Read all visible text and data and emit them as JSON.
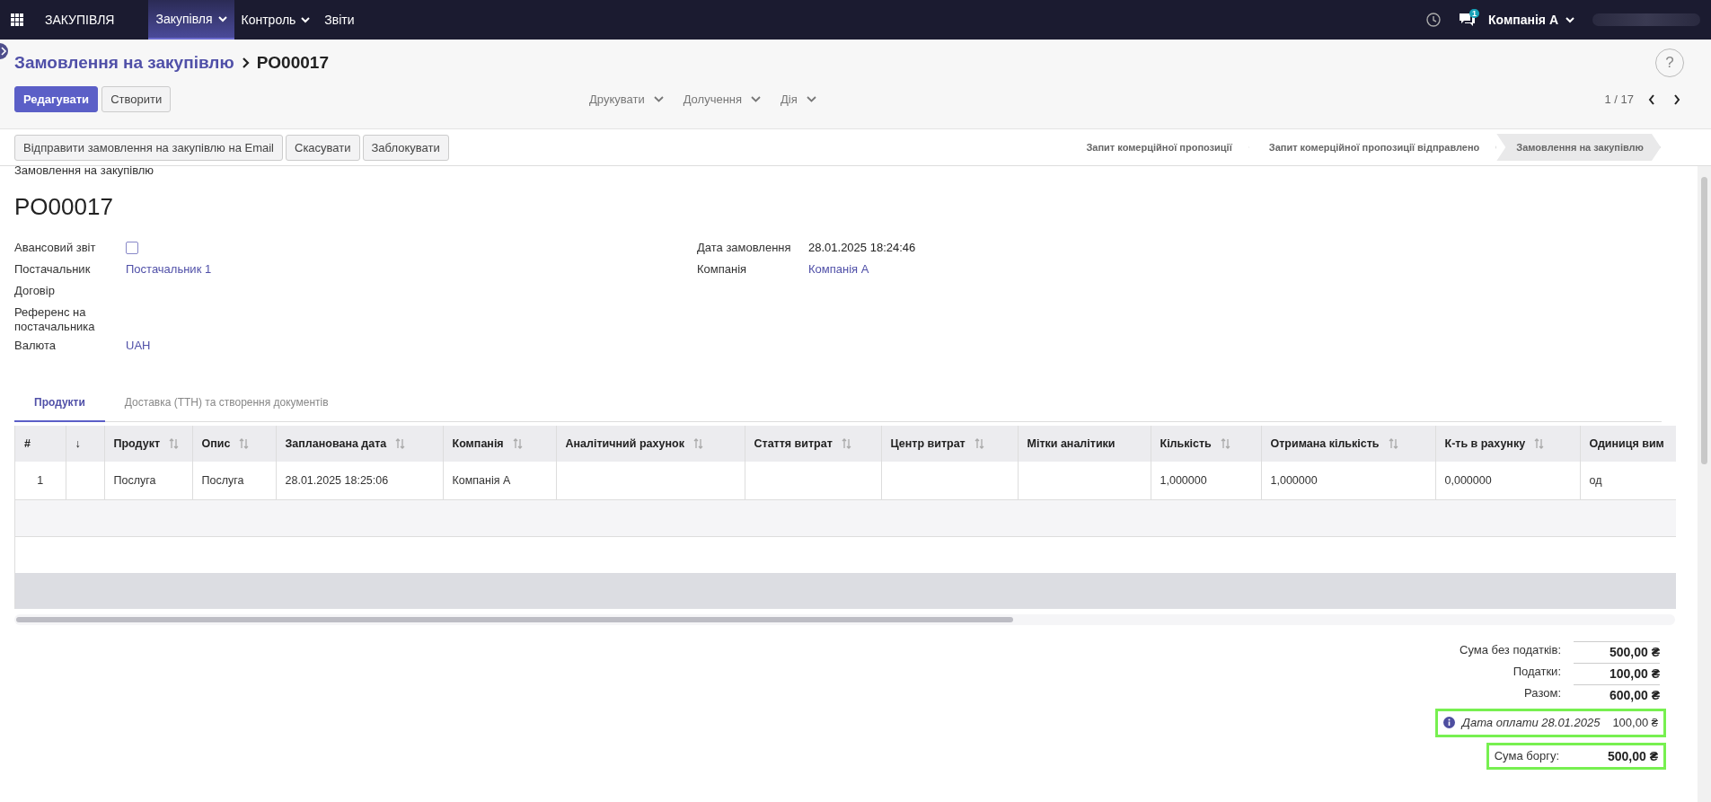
{
  "topbar": {
    "app_name": "ЗАКУПІВЛЯ",
    "menus": [
      {
        "label": "Закупівля",
        "selected": true,
        "has_caret": true
      },
      {
        "label": "Контроль",
        "selected": false,
        "has_caret": true
      },
      {
        "label": "Звіти",
        "selected": false,
        "has_caret": false
      }
    ],
    "chat_badge": "1",
    "company": "Компанія А"
  },
  "breadcrumb": {
    "parent": "Замовлення на закупівлю",
    "current": "PO00017"
  },
  "buttons": [
    {
      "label": "Редагувати",
      "kind": "primary"
    },
    {
      "label": "Створити",
      "kind": "secondary"
    }
  ],
  "dropdowns": [
    "Друкувати",
    "Долучення",
    "Дія"
  ],
  "pager": "1 / 17",
  "help": "?",
  "actions": [
    "Відправити замовлення на закупівлю на Email",
    "Скасувати",
    "Заблокувати"
  ],
  "stages": [
    {
      "label": "Запит комерційної пропозиції",
      "selected": false
    },
    {
      "label": "Запит комерційної пропозиції відправлено",
      "selected": false
    },
    {
      "label": "Замовлення на закупівлю",
      "selected": true
    }
  ],
  "form": {
    "subtitle": "Замовлення на закупівлю",
    "name": "PO00017",
    "left_fields": [
      {
        "label": "Авансовий звіт",
        "kind": "checkbox",
        "checked": false
      },
      {
        "label": "Постачальник",
        "kind": "link",
        "value": "Постачальник 1"
      },
      {
        "label": "Договір",
        "kind": "empty"
      },
      {
        "label": "Референс на постачальника",
        "kind": "empty"
      },
      {
        "label": "Валюта",
        "kind": "link",
        "value": "UAH"
      }
    ],
    "right_fields": [
      {
        "label": "Дата замовлення",
        "kind": "text",
        "value": "28.01.2025 18:24:46"
      },
      {
        "label": "Компанія",
        "kind": "link",
        "value": "Компанія А"
      }
    ]
  },
  "tabs": [
    {
      "label": "Продукти",
      "selected": true
    },
    {
      "label": "Доставка (ТТН) та створення документів",
      "selected": false
    }
  ],
  "table": {
    "columns": [
      {
        "label": "#",
        "sortable": false
      },
      {
        "label": "↓",
        "sortable": false
      },
      {
        "label": "Продукт",
        "sortable": true
      },
      {
        "label": "Опис",
        "sortable": true
      },
      {
        "label": "Запланована дата",
        "sortable": true
      },
      {
        "label": "Компанія",
        "sortable": true
      },
      {
        "label": "Аналітичний рахунок",
        "sortable": true
      },
      {
        "label": "Стаття витрат",
        "sortable": true
      },
      {
        "label": "Центр витрат",
        "sortable": true
      },
      {
        "label": "Мітки аналітики",
        "sortable": false
      },
      {
        "label": "Кількість",
        "sortable": true
      },
      {
        "label": "Отримана кількість",
        "sortable": true
      },
      {
        "label": "К-ть в рахунку",
        "sortable": true
      },
      {
        "label": "Одиниця вим"
      }
    ],
    "rows": [
      [
        "1",
        "",
        "Послуга",
        "Послуга",
        "28.01.2025 18:25:06",
        "Компанія А",
        "",
        "",
        "",
        "",
        "1,000000",
        "1,000000",
        "0,000000",
        "од"
      ]
    ]
  },
  "totals": [
    {
      "label": "Сума без податків:",
      "value": "500,00 ₴",
      "kind": "sum",
      "highlighted": false
    },
    {
      "label": "Податки:",
      "value": "100,00 ₴",
      "kind": "sum",
      "highlighted": false
    },
    {
      "label": "Разом:",
      "value": "600,00 ₴",
      "kind": "sum",
      "highlighted": false
    },
    {
      "label": "Дата оплати 28.01.2025",
      "value": "100,00 ₴",
      "kind": "payment",
      "highlighted": true
    },
    {
      "label": "Сума боргу:",
      "value": "500,00 ₴",
      "kind": "sum",
      "highlighted": true
    }
  ]
}
